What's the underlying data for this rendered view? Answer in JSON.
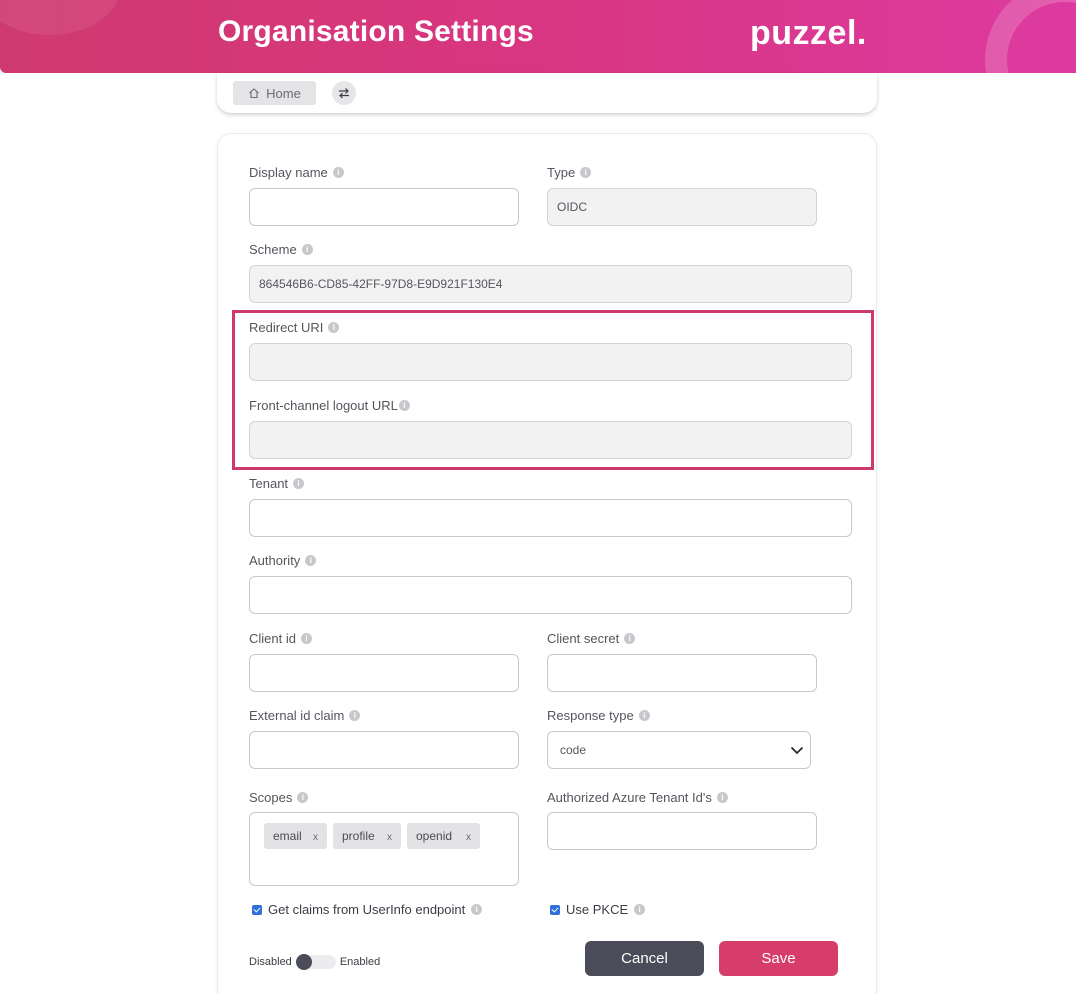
{
  "header": {
    "title": "Organisation Settings",
    "logo": "puzzel."
  },
  "breadcrumb": {
    "home_label": "Home",
    "home_icon": "home-icon",
    "switch_icon": "swap-icon"
  },
  "form": {
    "display_name": {
      "label": "Display name",
      "value": ""
    },
    "type": {
      "label": "Type",
      "value": "OIDC"
    },
    "scheme": {
      "label": "Scheme",
      "value": "864546B6-CD85-42FF-97D8-E9D921F130E4"
    },
    "redirect_uri": {
      "label": "Redirect URI",
      "value": ""
    },
    "front_channel_logout": {
      "label": "Front-channel logout URL",
      "value": ""
    },
    "tenant": {
      "label": "Tenant",
      "value": ""
    },
    "authority": {
      "label": "Authority",
      "value": ""
    },
    "client_id": {
      "label": "Client id",
      "value": ""
    },
    "client_secret": {
      "label": "Client secret",
      "value": ""
    },
    "external_id_claim": {
      "label": "External id claim",
      "value": ""
    },
    "response_type": {
      "label": "Response type",
      "value": "code"
    },
    "scopes": {
      "label": "Scopes",
      "tags": [
        "email",
        "profile",
        "openid"
      ],
      "remove_label": "x"
    },
    "authorized_azure_tenants": {
      "label": "Authorized Azure Tenant Id's",
      "value": ""
    },
    "get_claims_checkbox": {
      "label": "Get claims from UserInfo endpoint",
      "checked": true
    },
    "use_pkce_checkbox": {
      "label": "Use PKCE",
      "checked": true
    },
    "toggle": {
      "off_label": "Disabled",
      "on_label": "Enabled",
      "enabled": false
    },
    "info_glyph": "i"
  },
  "actions": {
    "cancel": "Cancel",
    "save": "Save"
  },
  "colors": {
    "brand": "#d63d6b",
    "dark_button": "#4b4c59",
    "highlight": "#cf3a6e",
    "checkbox": "#2f6fd8"
  }
}
